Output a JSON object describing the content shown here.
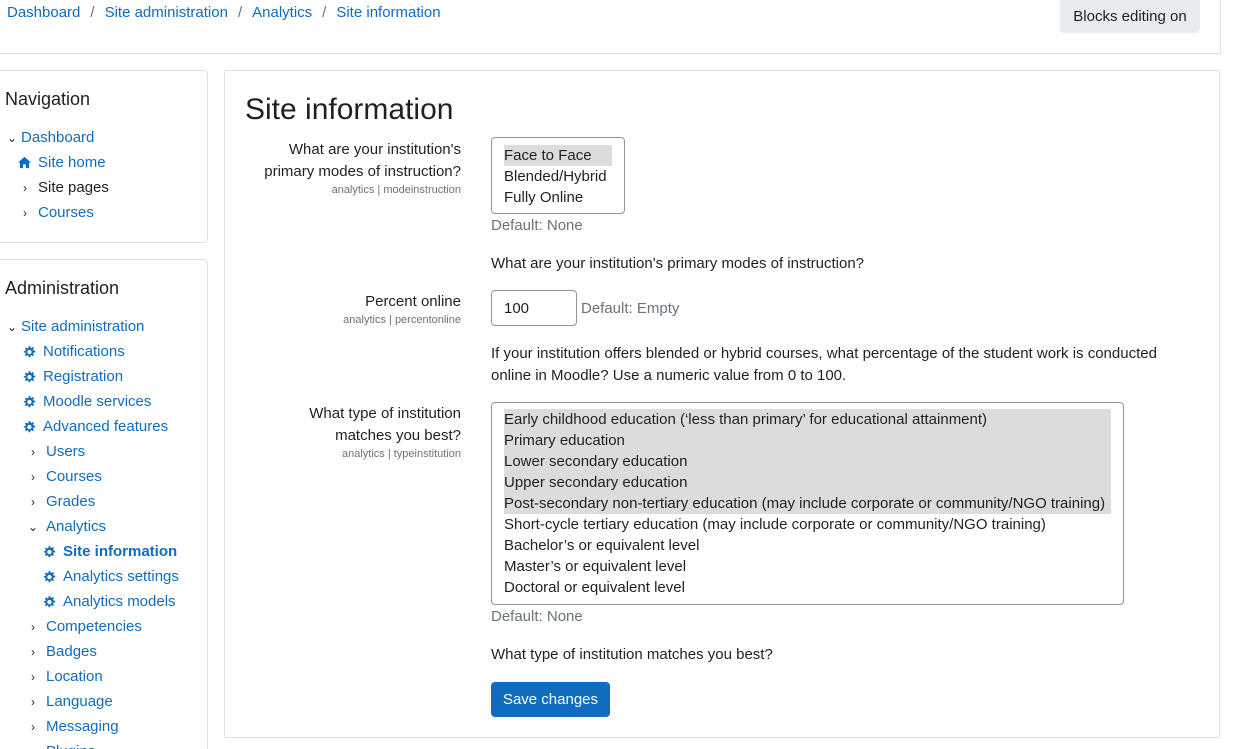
{
  "breadcrumb": [
    "Dashboard",
    "Site administration",
    "Analytics",
    "Site information"
  ],
  "blocks_button": "Blocks editing on",
  "navigation": {
    "title": "Navigation",
    "items": [
      {
        "label": "Dashboard",
        "icon": "chevron-down"
      },
      {
        "label": "Site home",
        "icon": "home-icon"
      },
      {
        "label": "Site pages",
        "icon": "chevron-right"
      },
      {
        "label": "Courses",
        "icon": "chevron-right"
      }
    ]
  },
  "administration": {
    "title": "Administration",
    "items": [
      {
        "label": "Site administration",
        "icon": "chevron-down"
      },
      {
        "label": "Notifications",
        "icon": "gear-icon"
      },
      {
        "label": "Registration",
        "icon": "gear-icon"
      },
      {
        "label": "Moodle services",
        "icon": "gear-icon"
      },
      {
        "label": "Advanced features",
        "icon": "gear-icon"
      },
      {
        "label": "Users",
        "icon": "chevron-right"
      },
      {
        "label": "Courses",
        "icon": "chevron-right"
      },
      {
        "label": "Grades",
        "icon": "chevron-right"
      },
      {
        "label": "Analytics",
        "icon": "chevron-down"
      },
      {
        "label": "Site information",
        "icon": "gear-icon"
      },
      {
        "label": "Analytics settings",
        "icon": "gear-icon"
      },
      {
        "label": "Analytics models",
        "icon": "gear-icon"
      },
      {
        "label": "Competencies",
        "icon": "chevron-right"
      },
      {
        "label": "Badges",
        "icon": "chevron-right"
      },
      {
        "label": "Location",
        "icon": "chevron-right"
      },
      {
        "label": "Language",
        "icon": "chevron-right"
      },
      {
        "label": "Messaging",
        "icon": "chevron-right"
      },
      {
        "label": "Plugins",
        "icon": "chevron-right"
      }
    ]
  },
  "main": {
    "title": "Site information",
    "modes": {
      "label_line1": "What are your institution's",
      "label_line2": "primary modes of instruction?",
      "key": "analytics | modeinstruction",
      "options": [
        "Face to Face",
        "Blended/Hybrid",
        "Fully Online"
      ],
      "default": "Default: None",
      "description": "What are your institution's primary modes of instruction?"
    },
    "percent": {
      "label": "Percent online",
      "key": "analytics | percentonline",
      "value": "100",
      "default": "Default: Empty",
      "description_line1": "If your institution offers blended or hybrid courses, what percentage of the student work is conducted",
      "description_line2": "online in Moodle? Use a numeric value from 0 to 100."
    },
    "type": {
      "label_line1": "What type of institution",
      "label_line2": "matches you best?",
      "key": "analytics | typeinstitution",
      "options": [
        "Early childhood education (‘less than primary’ for educational attainment)",
        "Primary education",
        "Lower secondary education",
        "Upper secondary education",
        "Post-secondary non-tertiary education (may include corporate or community/NGO training)",
        "Short-cycle tertiary education (may include corporate or community/NGO training)",
        "Bachelor’s or equivalent level",
        "Master’s or equivalent level",
        "Doctoral or equivalent level"
      ],
      "default": "Default: None",
      "description": "What type of institution matches you best?"
    },
    "save": "Save changes"
  }
}
